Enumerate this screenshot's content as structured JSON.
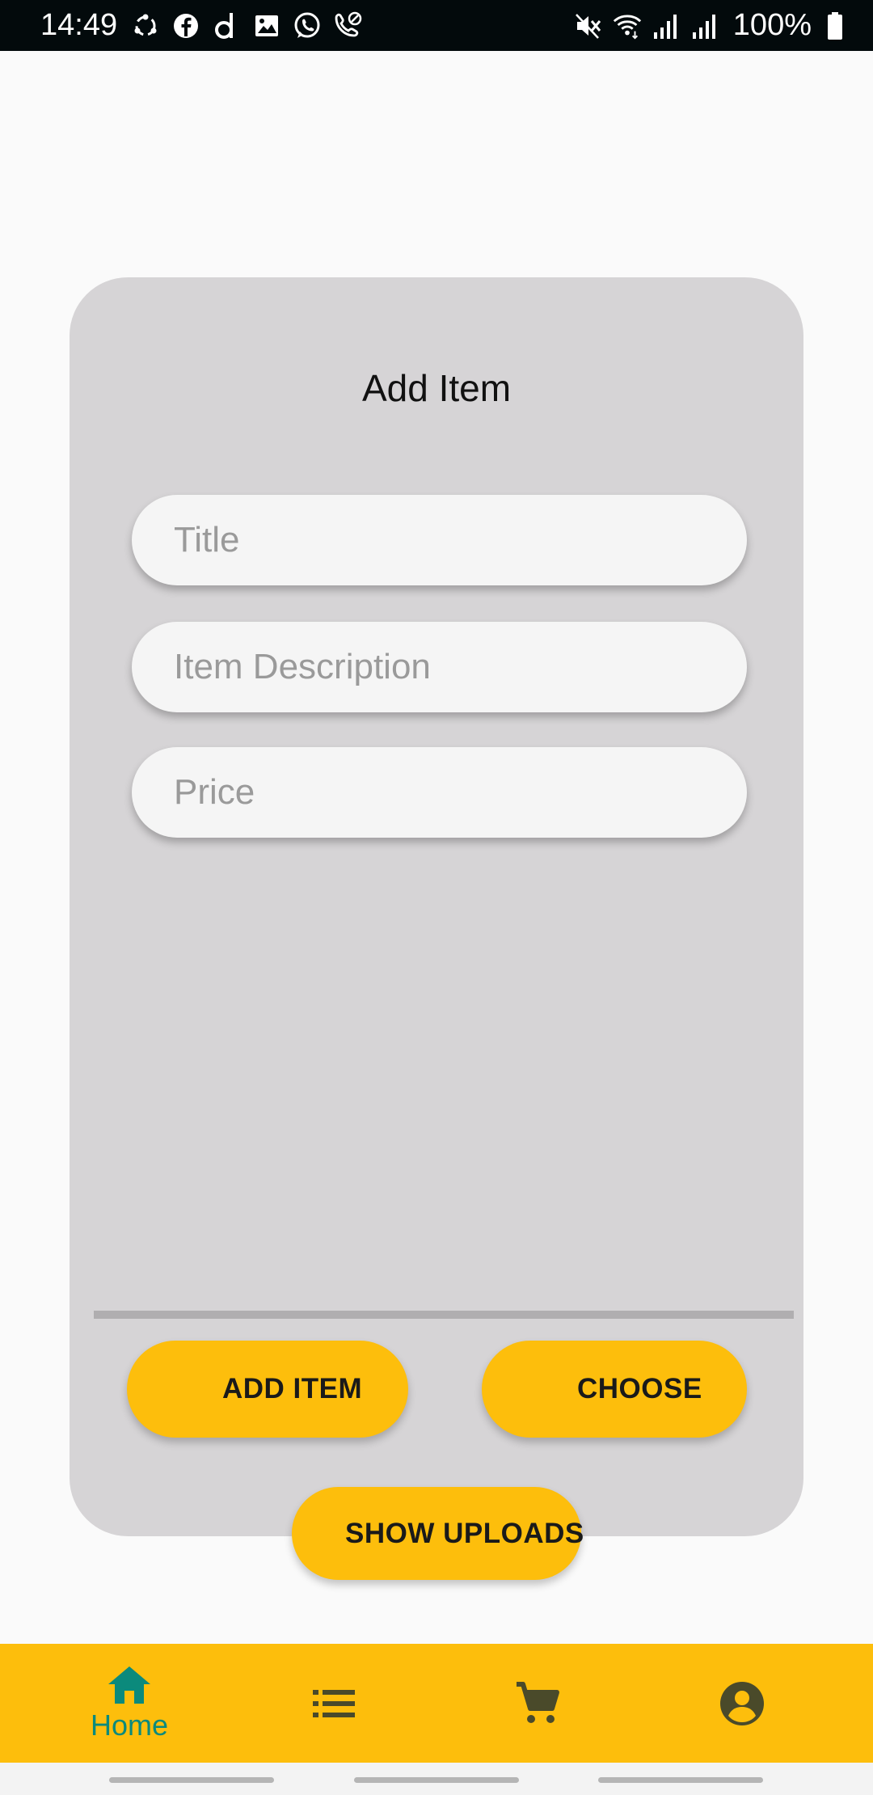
{
  "status_bar": {
    "time": "14:49",
    "left_icons": [
      "sync-icon",
      "facebook-icon",
      "d-app-icon",
      "gallery-icon",
      "whatsapp-icon",
      "wifi-call-icon"
    ],
    "right_icons": [
      "mute-icon",
      "wifi-icon",
      "signal-icon",
      "signal-icon"
    ],
    "battery": "100%"
  },
  "form": {
    "title": "Add Item",
    "fields": [
      {
        "placeholder": "Title",
        "value": ""
      },
      {
        "placeholder": "Item Description",
        "value": ""
      },
      {
        "placeholder": "Price",
        "value": ""
      }
    ],
    "buttons": {
      "add_item": "ADD ITEM",
      "choose": "CHOOSE",
      "show_uploads": "SHOW UPLOADS"
    }
  },
  "bottom_nav": {
    "items": [
      {
        "icon": "home-icon",
        "label": "Home",
        "active": true
      },
      {
        "icon": "list-icon",
        "label": "",
        "active": false
      },
      {
        "icon": "cart-icon",
        "label": "",
        "active": false
      },
      {
        "icon": "account-icon",
        "label": "",
        "active": false
      }
    ]
  },
  "colors": {
    "accent": "#fdbe0c",
    "active_nav": "#0b8a7c",
    "card_bg": "#d6d4d6",
    "inactive_icon": "#4a4a2a"
  }
}
